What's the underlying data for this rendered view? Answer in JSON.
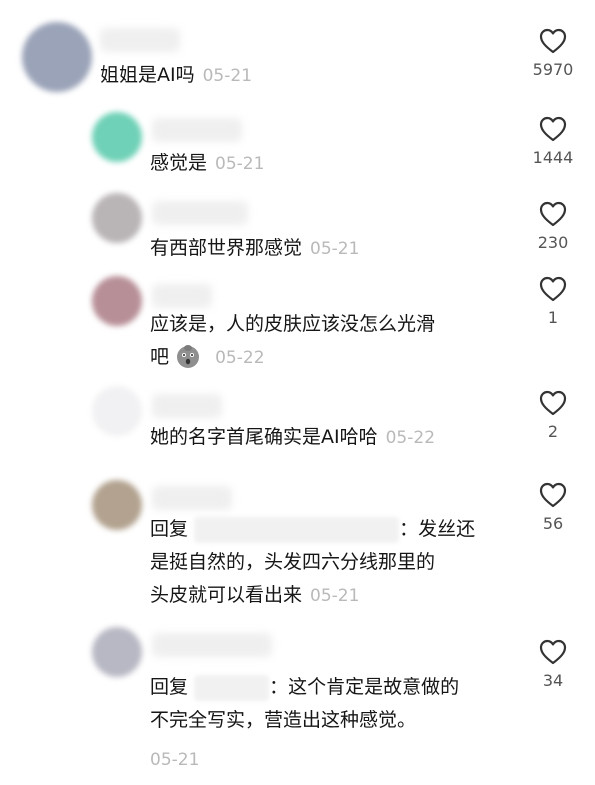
{
  "comments": [
    {
      "text": "姐姐是AI吗",
      "date": "05-21",
      "likes": "5970"
    },
    {
      "text": "感觉是",
      "date": "05-21",
      "likes": "1444"
    },
    {
      "text": "有西部世界那感觉",
      "date": "05-21",
      "likes": "230"
    },
    {
      "line1": "应该是，人的皮肤应该没怎么光滑",
      "line2": "吧",
      "date": "05-22",
      "likes": "1",
      "emoji": "gasp-face-emoji"
    },
    {
      "text": "她的名字首尾确实是AI哈哈",
      "date": "05-22",
      "likes": "2"
    },
    {
      "reply": "回复",
      "line1_end": "：发丝还",
      "line2": "是挺自然的，头发四六分线那里的",
      "line3": "头皮就可以看出来",
      "date": "05-21",
      "likes": "56"
    },
    {
      "reply": "回复",
      "line1_end": "：这个肯定是故意做的",
      "line2": "不完全写实，营造出这种感觉。",
      "date": "05-21",
      "likes": "34"
    }
  ],
  "icons": {
    "like": "heart-outline-icon"
  },
  "colors": {
    "date": "#b9b9b9",
    "text": "#161616",
    "like": "#333333"
  }
}
